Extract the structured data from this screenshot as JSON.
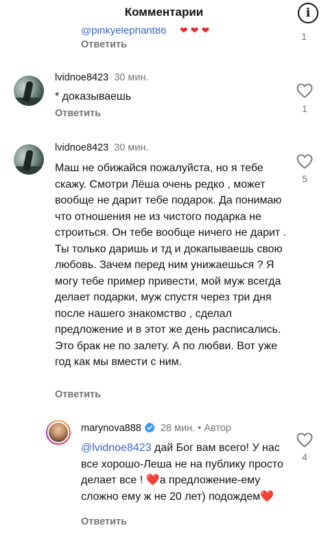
{
  "header": {
    "title": "Комментарии",
    "info_icon": "i"
  },
  "previous": {
    "mention_fragment": "@pinkyelephant86",
    "hearts": "❤❤❤",
    "reply_label": "Ответить",
    "like_count": "1"
  },
  "comments": [
    {
      "username": "lvidnoe8423",
      "time": "30 мин.",
      "text": "* доказываешь",
      "reply_label": "Ответить",
      "like_count": "1"
    },
    {
      "username": "lvidnoe8423",
      "time": "30 мин.",
      "text": "Маш не обижайся пожалуйста, но я тебе скажу.  Смотри Лёша очень редко , может вообще не дарит тебе подарок. Да понимаю что отношения не из чистого подарка не строиться.  Он тебе вообще ничего не дарит . Ты только даришь и тд и докапываешь свою любовь. Зачем перед ним унижаешься ? Я могу тебе пример привести, мой муж всегда делает подарки, муж спустя через  три дня после нашего знакомство , сделал предложение и в этот же день расписались.  Это брак не по залету.  А по любви.  Вот уже год как мы вмести с ним.",
      "reply_label": "Ответить",
      "like_count": "5"
    }
  ],
  "reply": {
    "username": "marynova888",
    "time": "28 мин.",
    "separator": "•",
    "author_label": "Автор",
    "mention": "@lvidnoe8423",
    "text_part1": " дай Бог вам всего! У нас все хорошо-Леша не на публику просто делает все ! ",
    "heart1": "❤️",
    "text_part2": "а предложение-ему сложно ему ж не 20 лет) подождем",
    "heart2": "❤️",
    "reply_label": "Ответить",
    "like_count": "4"
  },
  "colors": {
    "accent": "#3a63c9",
    "muted": "#737373",
    "heart": "#e02b2b",
    "verified": "#3897f0"
  }
}
